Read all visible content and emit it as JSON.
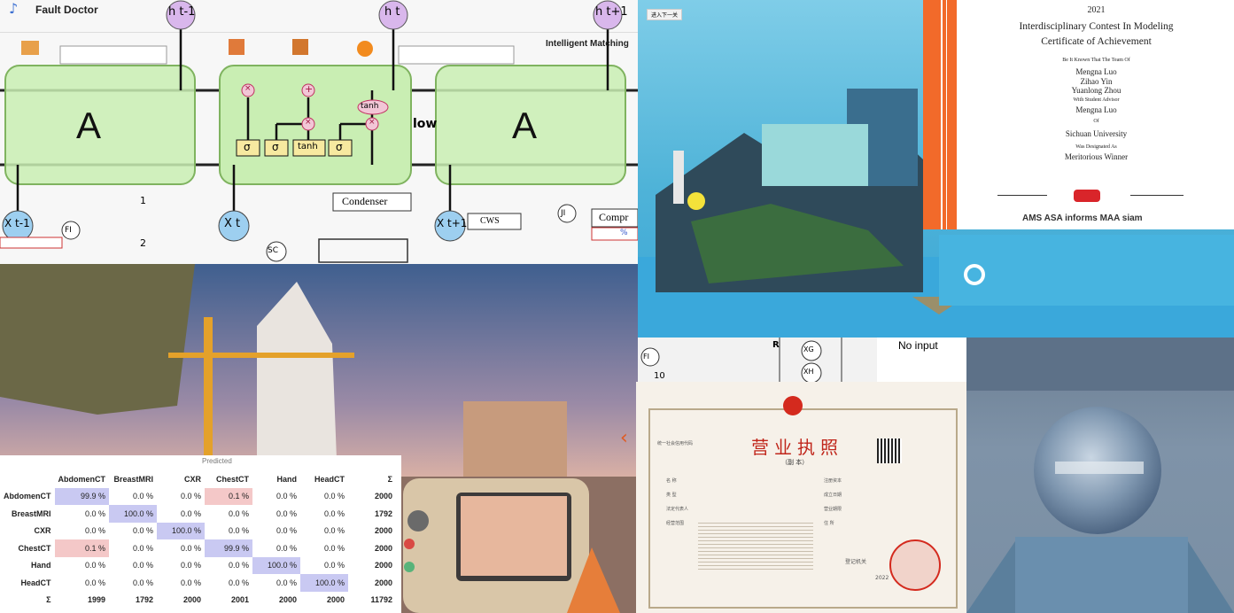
{
  "lstm": {
    "app_title": "Fault Doctor",
    "tab_intelligent": "Intelligent Matching",
    "top_labels": [
      "h t-1",
      "h t",
      "h t+1"
    ],
    "bottom_labels": [
      "X t-1",
      "X t",
      "X t+1"
    ],
    "block_label": "A",
    "gate_labels": [
      "σ",
      "σ",
      "tanh",
      "σ"
    ],
    "cell_tanh": "tanh",
    "ops": {
      "mult": "×",
      "add": "+"
    },
    "pid_labels": {
      "condenser": "Condenser",
      "cws": "CWS",
      "compr": "Compr",
      "pct": "%",
      "sc": "SC",
      "ji": "JI",
      "fi": "FI",
      "flow": "low",
      "num1": "1",
      "num2": "2"
    }
  },
  "game": {
    "button_label": "进入下一关"
  },
  "certificate": {
    "year": "2021",
    "title_line1": "Interdisciplinary Contest In Modeling",
    "title_line2": "Certificate of Achievement",
    "intro": "Be It Known That The Team Of",
    "members": [
      "Mengna Luo",
      "Zihao Yin",
      "Yuanlong Zhou"
    ],
    "advisor_intro": "With Student Advisor",
    "advisor": "Mengna Luo",
    "of": "Of",
    "university": "Sichuan University",
    "designated": "Was Designated As",
    "award": "Meritorious Winner",
    "sponsors": "AMS ASA informs MAA siam"
  },
  "confusion_matrix": {
    "axis_title": "Predicted",
    "columns": [
      "AbdomenCT",
      "BreastMRI",
      "CXR",
      "ChestCT",
      "Hand",
      "HeadCT",
      "Σ"
    ],
    "rows": [
      {
        "label": "AbdomenCT",
        "cells": [
          "99.9 %",
          "0.0 %",
          "0.0 %",
          "0.1 %",
          "0.0 %",
          "0.0 %"
        ],
        "sum": "2000"
      },
      {
        "label": "BreastMRI",
        "cells": [
          "0.0 %",
          "100.0 %",
          "0.0 %",
          "0.0 %",
          "0.0 %",
          "0.0 %"
        ],
        "sum": "1792"
      },
      {
        "label": "CXR",
        "cells": [
          "0.0 %",
          "0.0 %",
          "100.0 %",
          "0.0 %",
          "0.0 %",
          "0.0 %"
        ],
        "sum": "2000"
      },
      {
        "label": "ChestCT",
        "cells": [
          "0.1 %",
          "0.0 %",
          "0.0 %",
          "99.9 %",
          "0.0 %",
          "0.0 %"
        ],
        "sum": "2000"
      },
      {
        "label": "Hand",
        "cells": [
          "0.0 %",
          "0.0 %",
          "0.0 %",
          "0.0 %",
          "100.0 %",
          "0.0 %"
        ],
        "sum": "2000"
      },
      {
        "label": "HeadCT",
        "cells": [
          "0.0 %",
          "0.0 %",
          "0.0 %",
          "0.0 %",
          "0.0 %",
          "100.0 %"
        ],
        "sum": "2000"
      }
    ],
    "totals_label": "Σ",
    "totals": [
      "1999",
      "1792",
      "2000",
      "2001",
      "2000",
      "2000",
      "11792"
    ],
    "colors": {
      "diag": "#c9c9f2",
      "offdiag": "#f4c8c8"
    }
  },
  "pid_strip": {
    "no_input": "No input",
    "labels": [
      "R",
      "XG",
      "XH",
      "FI",
      "10"
    ]
  },
  "license": {
    "title": "营业执照",
    "subtitle": "（副 本）",
    "credit_code_label": "统一社会信用代码",
    "field_labels": [
      "名 称",
      "类 型",
      "法定代表人",
      "经营范围"
    ],
    "right_labels": [
      "注册资本",
      "成立日期",
      "营业期限",
      "住 所"
    ],
    "registrar": "登记机关",
    "year": "2022"
  },
  "scene": {
    "nav_arrow": "‹"
  }
}
